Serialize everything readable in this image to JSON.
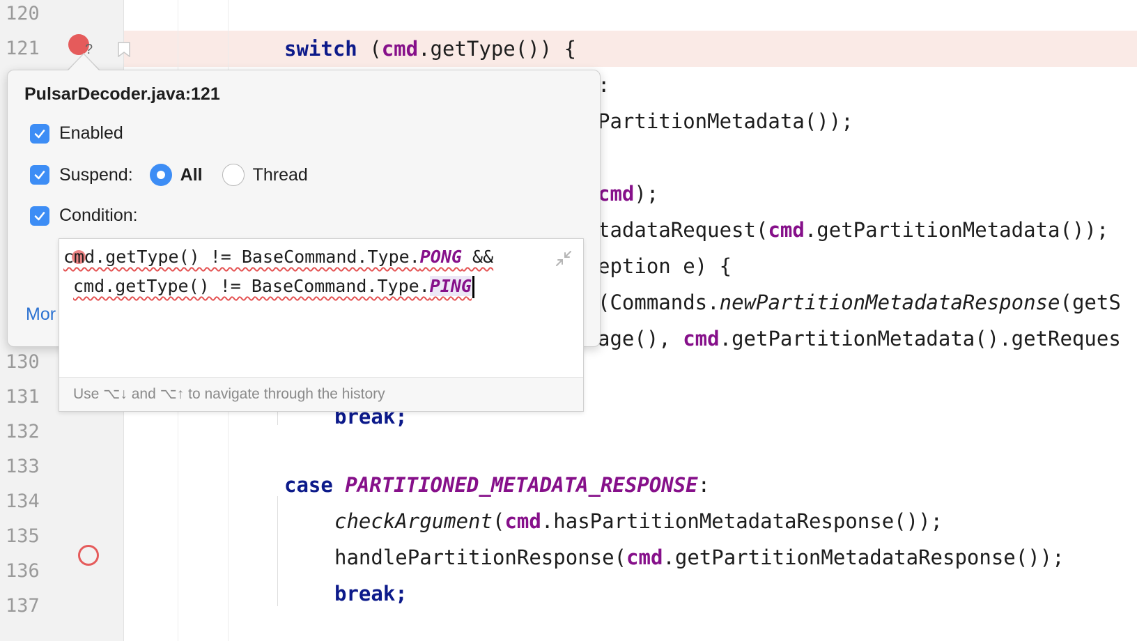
{
  "gutter": {
    "line_numbers": [
      "120",
      "121",
      "130",
      "131",
      "132",
      "133",
      "134",
      "135",
      "136",
      "137"
    ]
  },
  "code": {
    "line121": {
      "kw": "switch",
      "open": " (",
      "var": "cmd",
      "rest": ".getType()) {"
    },
    "frag1": ":",
    "frag2": "PartitionMetadata());",
    "frag3_var": "cmd",
    "frag3_rest": ");",
    "frag4_pre": "tadataRequest(",
    "frag4_var": "cmd",
    "frag4_rest": ".getPartitionMetadata());",
    "frag5": "eption e) {",
    "frag6_pre": "(Commands.",
    "frag6_it": "newPartitionMetadataResponse",
    "frag6_rest": "(getS",
    "frag7_pre": "age(), ",
    "frag7_var": "cmd",
    "frag7_rest": ".getPartitionMetadata().getReques",
    "line131": "break;",
    "line133": {
      "kw": "case",
      "const": "PARTITIONED_METADATA_RESPONSE",
      "colon": ":"
    },
    "line134": {
      "method": "checkArgument",
      "open": "(",
      "var": "cmd",
      "rest": ".hasPartitionMetadataResponse());"
    },
    "line135": {
      "pre": "handlePartitionResponse(",
      "var": "cmd",
      "rest": ".getPartitionMetadataResponse());"
    },
    "line136": "break;"
  },
  "popup": {
    "title": "PulsarDecoder.java:121",
    "enabled_label": "Enabled",
    "suspend_label": "Suspend:",
    "radio_all_label": "All",
    "radio_thread_label": "Thread",
    "condition_label": "Condition:",
    "more_label": "Mor",
    "condition": {
      "line1_pre": "cmd.getType() != BaseCommand.Type.",
      "line1_const": "PONG",
      "line1_post": " &&",
      "line2_pre": "cmd.getType() != BaseCommand.Type.",
      "line2_const": "PING"
    },
    "hint": "Use ⌥↓ and ⌥↑ to navigate through the history"
  },
  "colors": {
    "keyword": "#0c1a8a",
    "variable": "#86108a",
    "breakpoint": "#e55b5b",
    "accent": "#3d8df5",
    "highlight_row": "#faeae6"
  },
  "icons": [
    "breakpoint-icon",
    "conditional-breakpoint-icon",
    "bookmark-icon",
    "checkbox-icon",
    "radio-icon",
    "collapse-icon",
    "intention-bulb-icon",
    "empty-breakpoint-icon"
  ]
}
